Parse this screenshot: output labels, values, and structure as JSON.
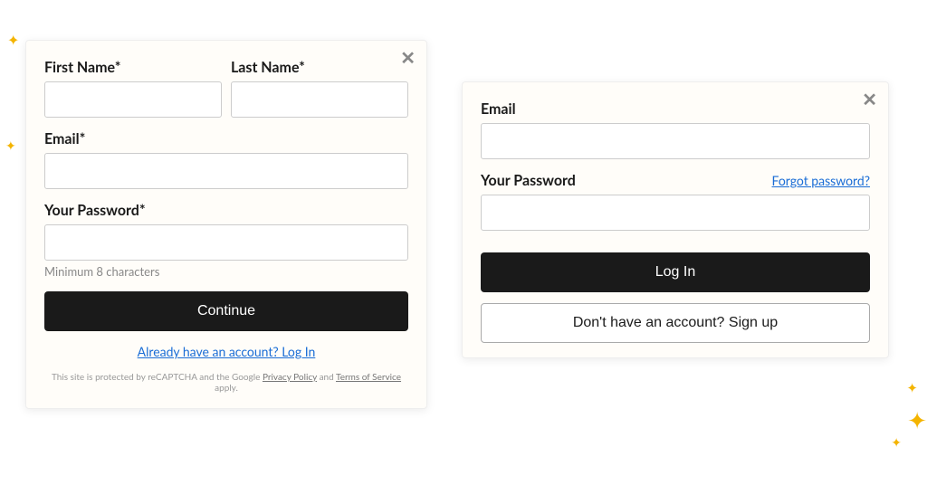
{
  "signup": {
    "first_name_label": "First Name*",
    "last_name_label": "Last Name*",
    "email_label": "Email*",
    "password_label": "Your Password*",
    "password_hint": "Minimum 8 characters",
    "submit_label": "Continue",
    "switch_link": "Already have an account? Log In",
    "legal_prefix": "This site is protected by reCAPTCHA and the Google ",
    "legal_privacy": "Privacy Policy",
    "legal_and": " and ",
    "legal_terms": "Terms of Service",
    "legal_suffix": " apply."
  },
  "login": {
    "email_label": "Email",
    "password_label": "Your Password",
    "forgot_link": "Forgot password?",
    "submit_label": "Log In",
    "switch_label": "Don't have an account? Sign up"
  }
}
